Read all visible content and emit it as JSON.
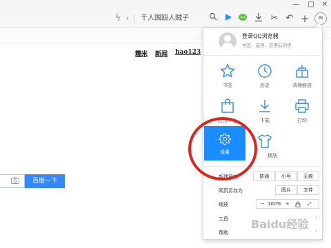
{
  "toolbar": {
    "address_text": "千人围殴人贼子",
    "icons": [
      "lightning-icon",
      "chevron-right-icon",
      "search-icon",
      "play-icon",
      "chat-icon",
      "download-icon",
      "scissors-icon",
      "undo-icon",
      "plus-icon",
      "menu-icon"
    ]
  },
  "window": {
    "minimize": "—",
    "maximize": "□",
    "close": "✕"
  },
  "page": {
    "links": [
      "糯米",
      "新闻",
      "hao123"
    ],
    "search_button": "百度一下"
  },
  "menu": {
    "login_title": "登录QQ浏览器",
    "login_subtitle": "书签、选项、应用云同步",
    "grid": [
      {
        "label": "书签",
        "icon": "star-icon"
      },
      {
        "label": "历史",
        "icon": "clock-icon"
      },
      {
        "label": "清理痕迹",
        "icon": "clean-icon"
      },
      {
        "label": "应用中心",
        "icon": "bag-icon"
      },
      {
        "label": "下载",
        "icon": "download-icon"
      },
      {
        "label": "打印",
        "icon": "printer-icon"
      },
      {
        "label": "设置",
        "icon": "gear-icon"
      },
      {
        "label": "换肤",
        "icon": "shirt-icon"
      }
    ],
    "new_window_label": "新建窗口",
    "window_options": [
      "普通",
      "小号",
      "无痕"
    ],
    "save_as_label": "网页另存为",
    "save_options": [
      "图片",
      "文件"
    ],
    "zoom_label": "缩放",
    "zoom_minus": "−",
    "zoom_value": "100%",
    "zoom_plus": "+",
    "tools_label": "工具",
    "help_label": "帮助"
  },
  "watermark": "Baidu经验",
  "colors": {
    "accent": "#1a8cff",
    "highlight_ring": "#e62117",
    "icon_blue": "#2e8be6"
  }
}
